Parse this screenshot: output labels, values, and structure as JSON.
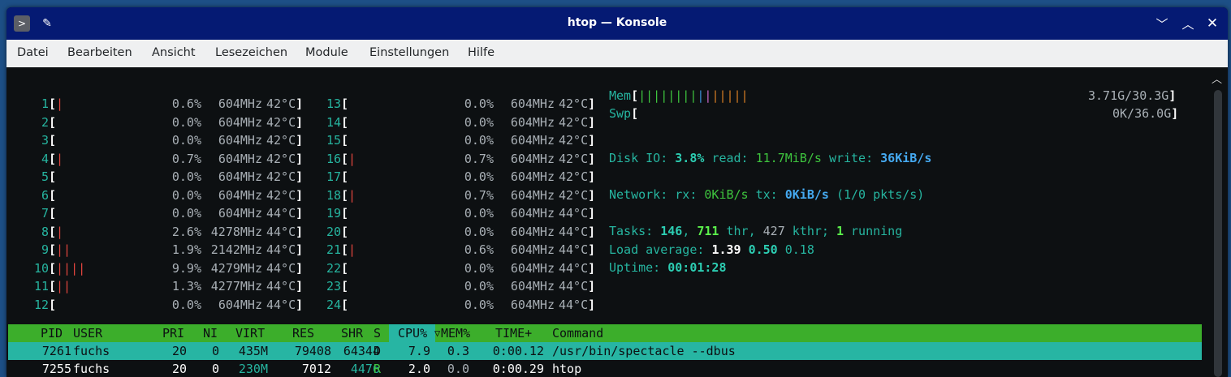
{
  "window": {
    "title": "htop — Konsole"
  },
  "icons": {
    "terminal": "terminal-icon",
    "pin": "pin-icon",
    "minimize": "minimize-icon",
    "maximize": "maximize-icon",
    "close": "close-icon"
  },
  "menubar": [
    "Datei",
    "Bearbeiten",
    "Ansicht",
    "Lesezeichen",
    "Module",
    "Einstellungen",
    "Hilfe"
  ],
  "cpus": [
    {
      "id": "1",
      "bars": "|",
      "pct": "0.6%",
      "mhz": "604MHz",
      "temp": "42°C"
    },
    {
      "id": "2",
      "bars": "",
      "pct": "0.0%",
      "mhz": "604MHz",
      "temp": "42°C"
    },
    {
      "id": "3",
      "bars": "",
      "pct": "0.0%",
      "mhz": "604MHz",
      "temp": "42°C"
    },
    {
      "id": "4",
      "bars": "|",
      "pct": "0.7%",
      "mhz": "604MHz",
      "temp": "42°C"
    },
    {
      "id": "5",
      "bars": "",
      "pct": "0.0%",
      "mhz": "604MHz",
      "temp": "42°C"
    },
    {
      "id": "6",
      "bars": "",
      "pct": "0.0%",
      "mhz": "604MHz",
      "temp": "42°C"
    },
    {
      "id": "7",
      "bars": "",
      "pct": "0.0%",
      "mhz": "604MHz",
      "temp": "44°C"
    },
    {
      "id": "8",
      "bars": "|",
      "pct": "2.6%",
      "mhz": "4278MHz",
      "temp": "44°C"
    },
    {
      "id": "9",
      "bars": "||",
      "pct": "1.9%",
      "mhz": "2142MHz",
      "temp": "44°C"
    },
    {
      "id": "10",
      "bars": "||||",
      "pct": "9.9%",
      "mhz": "4279MHz",
      "temp": "44°C"
    },
    {
      "id": "11",
      "bars": "||",
      "pct": "1.3%",
      "mhz": "4277MHz",
      "temp": "44°C"
    },
    {
      "id": "12",
      "bars": "",
      "pct": "0.0%",
      "mhz": "604MHz",
      "temp": "44°C"
    },
    {
      "id": "13",
      "bars": "",
      "pct": "0.0%",
      "mhz": "604MHz",
      "temp": "42°C"
    },
    {
      "id": "14",
      "bars": "",
      "pct": "0.0%",
      "mhz": "604MHz",
      "temp": "42°C"
    },
    {
      "id": "15",
      "bars": "",
      "pct": "0.0%",
      "mhz": "604MHz",
      "temp": "42°C"
    },
    {
      "id": "16",
      "bars": "|",
      "pct": "0.7%",
      "mhz": "604MHz",
      "temp": "42°C"
    },
    {
      "id": "17",
      "bars": "",
      "pct": "0.0%",
      "mhz": "604MHz",
      "temp": "42°C"
    },
    {
      "id": "18",
      "bars": "|",
      "pct": "0.7%",
      "mhz": "604MHz",
      "temp": "42°C"
    },
    {
      "id": "19",
      "bars": "",
      "pct": "0.0%",
      "mhz": "604MHz",
      "temp": "44°C"
    },
    {
      "id": "20",
      "bars": "",
      "pct": "0.0%",
      "mhz": "604MHz",
      "temp": "44°C"
    },
    {
      "id": "21",
      "bars": "|",
      "pct": "0.6%",
      "mhz": "604MHz",
      "temp": "44°C"
    },
    {
      "id": "22",
      "bars": "",
      "pct": "0.0%",
      "mhz": "604MHz",
      "temp": "44°C"
    },
    {
      "id": "23",
      "bars": "",
      "pct": "0.0%",
      "mhz": "604MHz",
      "temp": "44°C"
    },
    {
      "id": "24",
      "bars": "",
      "pct": "0.0%",
      "mhz": "604MHz",
      "temp": "44°C"
    }
  ],
  "mem": {
    "label": "Mem",
    "bars": [
      "||||||||",
      "|",
      "|",
      "|||||"
    ],
    "value": "3.71G/30.3G"
  },
  "swp": {
    "label": "Swp",
    "value": "0K/36.0G"
  },
  "disk": {
    "label": "Disk IO:",
    "pct": "3.8%",
    "read_label": "read:",
    "read": "11.7MiB/s",
    "write_label": "write:",
    "write": "36KiB/s"
  },
  "network": {
    "label": "Network:",
    "rx_label": "rx:",
    "rx": "0KiB/s",
    "tx_label": "tx:",
    "tx": "0KiB/s",
    "pkts": "(1/0 pkts/s)"
  },
  "tasks": {
    "label": "Tasks:",
    "count": "146",
    "thr": "711",
    "thr_label": "thr,",
    "kthr": "427",
    "kthr_label": "kthr;",
    "running": "1",
    "running_label": "running"
  },
  "load": {
    "label": "Load average:",
    "l1": "1.39",
    "l5": "0.50",
    "l15": "0.18"
  },
  "uptime": {
    "label": "Uptime:",
    "value": "00:01:28"
  },
  "columns": [
    "PID",
    "USER",
    "PRI",
    "NI",
    "VIRT",
    "RES",
    "SHR",
    "S",
    "CPU%",
    "▽",
    "MEM%",
    "TIME+",
    "Command"
  ],
  "processes": [
    {
      "pid": "7261",
      "user": "fuchs",
      "pri": "20",
      "ni": "0",
      "virt": "435M",
      "res": "79408",
      "shr": "64344",
      "s": "D",
      "cpu": "7.9",
      "mem": "0.3",
      "time": "0:00.12",
      "cmd": "/usr/bin/spectacle --dbus"
    },
    {
      "pid": "7255",
      "user": "fuchs",
      "pri": "20",
      "ni": "0",
      "virt": "230M",
      "res": "7012",
      "shr": "4476",
      "s": "R",
      "cpu": "2.0",
      "mem": "0.0",
      "time": "0:00.29",
      "cmd": "htop"
    }
  ]
}
